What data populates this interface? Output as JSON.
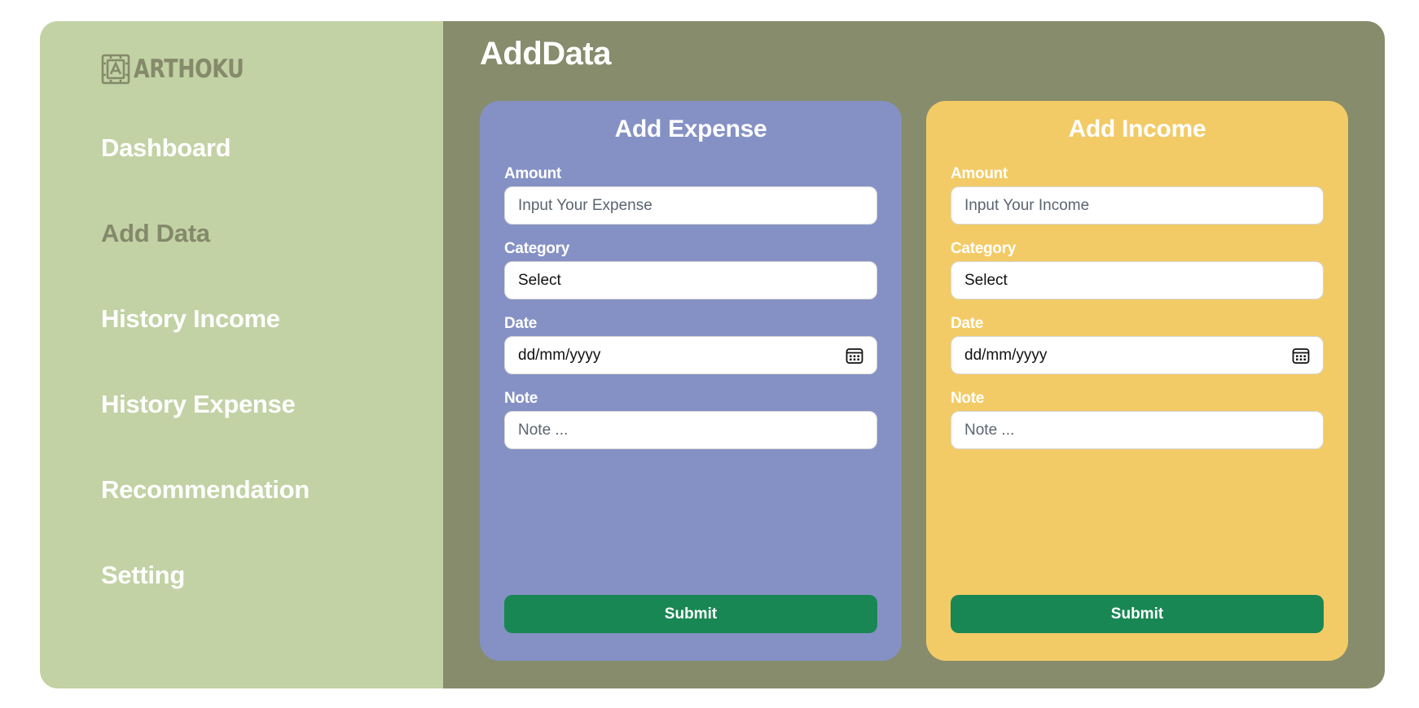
{
  "brand": {
    "logo_text": "ARTHOKU",
    "icon": "arthoku-logo-icon",
    "color": "#848a6a"
  },
  "sidebar": {
    "items": [
      {
        "label": "Dashboard",
        "active": false
      },
      {
        "label": "Add Data",
        "active": true
      },
      {
        "label": "History Income",
        "active": false
      },
      {
        "label": "History Expense",
        "active": false
      },
      {
        "label": "Recommendation",
        "active": false
      },
      {
        "label": "Setting",
        "active": false
      }
    ]
  },
  "page": {
    "title": "AddData"
  },
  "expense_form": {
    "title": "Add Expense",
    "amount_label": "Amount",
    "amount_placeholder": "Input Your Expense",
    "category_label": "Category",
    "category_value": "Select",
    "date_label": "Date",
    "date_value": "dd/mm/yyyy",
    "note_label": "Note",
    "note_placeholder": "Note ...",
    "submit_label": "Submit"
  },
  "income_form": {
    "title": "Add Income",
    "amount_label": "Amount",
    "amount_placeholder": "Input Your Income",
    "category_label": "Category",
    "category_value": "Select",
    "date_label": "Date",
    "date_value": "dd/mm/yyyy",
    "note_label": "Note",
    "note_placeholder": "Note ...",
    "submit_label": "Submit"
  },
  "colors": {
    "sidebar_bg": "#c2d2a4",
    "main_bg": "#878c6c",
    "expense_card": "#8591c4",
    "income_card": "#f3cb66",
    "submit_button": "#198754",
    "active_nav": "#84896b"
  }
}
